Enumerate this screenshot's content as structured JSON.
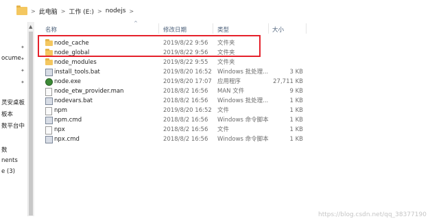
{
  "address": {
    "crumbs": [
      "此电脑",
      "工作 (E:)",
      "nodejs"
    ],
    "separator": ">"
  },
  "nav": {
    "items": [
      "ocume",
      "灵安桌板",
      "板本",
      "数平台中",
      "数",
      "nents",
      "e (3)"
    ],
    "pin_glyph": "✦",
    "up_glyph": "▲"
  },
  "columns": {
    "name": "名称",
    "date": "修改日期",
    "type": "类型",
    "size": "大小",
    "sort_glyph": "^"
  },
  "files": [
    {
      "name": "node_cache",
      "date": "2019/8/22 9:56",
      "type": "文件夹",
      "size": "",
      "icon": "folder-icon"
    },
    {
      "name": "node_global",
      "date": "2019/8/22 9:56",
      "type": "文件夹",
      "size": "",
      "icon": "folder-icon"
    },
    {
      "name": "node_modules",
      "date": "2019/8/22 9:55",
      "type": "文件夹",
      "size": "",
      "icon": "folder-icon"
    },
    {
      "name": "install_tools.bat",
      "date": "2019/8/20 16:52",
      "type": "Windows 批处理...",
      "size": "3 KB",
      "icon": "batch-file-icon"
    },
    {
      "name": "node.exe",
      "date": "2019/8/20 17:07",
      "type": "应用程序",
      "size": "27,711 KB",
      "icon": "node-exe-icon"
    },
    {
      "name": "node_etw_provider.man",
      "date": "2018/8/2 16:56",
      "type": "MAN 文件",
      "size": "9 KB",
      "icon": "file-icon"
    },
    {
      "name": "nodevars.bat",
      "date": "2018/8/2 16:56",
      "type": "Windows 批处理...",
      "size": "1 KB",
      "icon": "batch-file-icon"
    },
    {
      "name": "npm",
      "date": "2019/8/20 16:52",
      "type": "文件",
      "size": "1 KB",
      "icon": "file-icon"
    },
    {
      "name": "npm.cmd",
      "date": "2018/8/2 16:56",
      "type": "Windows 命令脚本",
      "size": "1 KB",
      "icon": "cmd-file-icon"
    },
    {
      "name": "npx",
      "date": "2018/8/2 16:56",
      "type": "文件",
      "size": "1 KB",
      "icon": "file-icon"
    },
    {
      "name": "npx.cmd",
      "date": "2018/8/2 16:56",
      "type": "Windows 命令脚本",
      "size": "1 KB",
      "icon": "cmd-file-icon"
    }
  ],
  "watermark": "https://blog.csdn.net/qq_38377190",
  "colors": {
    "highlight": "#e5202a",
    "folder": "#f4c760",
    "header_text": "#4c607a"
  }
}
